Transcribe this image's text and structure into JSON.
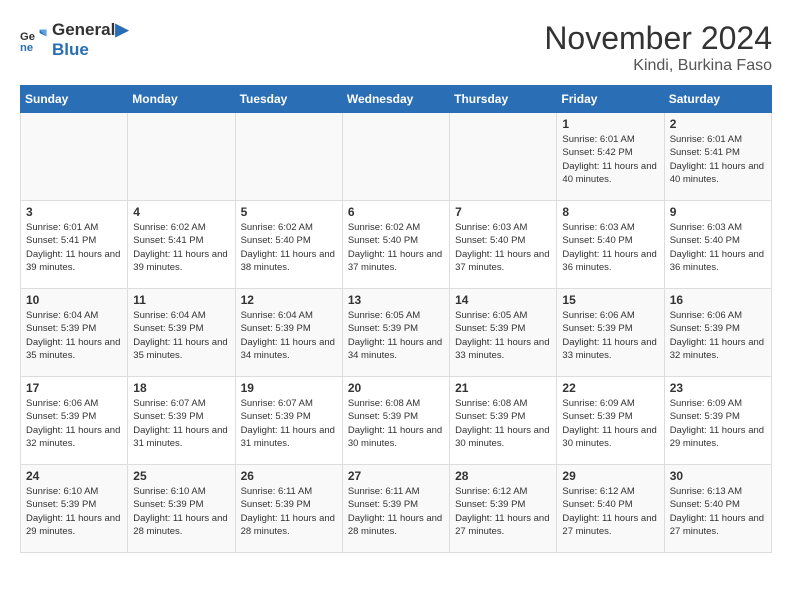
{
  "logo": {
    "line1": "General",
    "line2": "Blue"
  },
  "title": "November 2024",
  "subtitle": "Kindi, Burkina Faso",
  "days_of_week": [
    "Sunday",
    "Monday",
    "Tuesday",
    "Wednesday",
    "Thursday",
    "Friday",
    "Saturday"
  ],
  "weeks": [
    [
      {
        "day": "",
        "info": ""
      },
      {
        "day": "",
        "info": ""
      },
      {
        "day": "",
        "info": ""
      },
      {
        "day": "",
        "info": ""
      },
      {
        "day": "",
        "info": ""
      },
      {
        "day": "1",
        "info": "Sunrise: 6:01 AM\nSunset: 5:42 PM\nDaylight: 11 hours and 40 minutes."
      },
      {
        "day": "2",
        "info": "Sunrise: 6:01 AM\nSunset: 5:41 PM\nDaylight: 11 hours and 40 minutes."
      }
    ],
    [
      {
        "day": "3",
        "info": "Sunrise: 6:01 AM\nSunset: 5:41 PM\nDaylight: 11 hours and 39 minutes."
      },
      {
        "day": "4",
        "info": "Sunrise: 6:02 AM\nSunset: 5:41 PM\nDaylight: 11 hours and 39 minutes."
      },
      {
        "day": "5",
        "info": "Sunrise: 6:02 AM\nSunset: 5:40 PM\nDaylight: 11 hours and 38 minutes."
      },
      {
        "day": "6",
        "info": "Sunrise: 6:02 AM\nSunset: 5:40 PM\nDaylight: 11 hours and 37 minutes."
      },
      {
        "day": "7",
        "info": "Sunrise: 6:03 AM\nSunset: 5:40 PM\nDaylight: 11 hours and 37 minutes."
      },
      {
        "day": "8",
        "info": "Sunrise: 6:03 AM\nSunset: 5:40 PM\nDaylight: 11 hours and 36 minutes."
      },
      {
        "day": "9",
        "info": "Sunrise: 6:03 AM\nSunset: 5:40 PM\nDaylight: 11 hours and 36 minutes."
      }
    ],
    [
      {
        "day": "10",
        "info": "Sunrise: 6:04 AM\nSunset: 5:39 PM\nDaylight: 11 hours and 35 minutes."
      },
      {
        "day": "11",
        "info": "Sunrise: 6:04 AM\nSunset: 5:39 PM\nDaylight: 11 hours and 35 minutes."
      },
      {
        "day": "12",
        "info": "Sunrise: 6:04 AM\nSunset: 5:39 PM\nDaylight: 11 hours and 34 minutes."
      },
      {
        "day": "13",
        "info": "Sunrise: 6:05 AM\nSunset: 5:39 PM\nDaylight: 11 hours and 34 minutes."
      },
      {
        "day": "14",
        "info": "Sunrise: 6:05 AM\nSunset: 5:39 PM\nDaylight: 11 hours and 33 minutes."
      },
      {
        "day": "15",
        "info": "Sunrise: 6:06 AM\nSunset: 5:39 PM\nDaylight: 11 hours and 33 minutes."
      },
      {
        "day": "16",
        "info": "Sunrise: 6:06 AM\nSunset: 5:39 PM\nDaylight: 11 hours and 32 minutes."
      }
    ],
    [
      {
        "day": "17",
        "info": "Sunrise: 6:06 AM\nSunset: 5:39 PM\nDaylight: 11 hours and 32 minutes."
      },
      {
        "day": "18",
        "info": "Sunrise: 6:07 AM\nSunset: 5:39 PM\nDaylight: 11 hours and 31 minutes."
      },
      {
        "day": "19",
        "info": "Sunrise: 6:07 AM\nSunset: 5:39 PM\nDaylight: 11 hours and 31 minutes."
      },
      {
        "day": "20",
        "info": "Sunrise: 6:08 AM\nSunset: 5:39 PM\nDaylight: 11 hours and 30 minutes."
      },
      {
        "day": "21",
        "info": "Sunrise: 6:08 AM\nSunset: 5:39 PM\nDaylight: 11 hours and 30 minutes."
      },
      {
        "day": "22",
        "info": "Sunrise: 6:09 AM\nSunset: 5:39 PM\nDaylight: 11 hours and 30 minutes."
      },
      {
        "day": "23",
        "info": "Sunrise: 6:09 AM\nSunset: 5:39 PM\nDaylight: 11 hours and 29 minutes."
      }
    ],
    [
      {
        "day": "24",
        "info": "Sunrise: 6:10 AM\nSunset: 5:39 PM\nDaylight: 11 hours and 29 minutes."
      },
      {
        "day": "25",
        "info": "Sunrise: 6:10 AM\nSunset: 5:39 PM\nDaylight: 11 hours and 28 minutes."
      },
      {
        "day": "26",
        "info": "Sunrise: 6:11 AM\nSunset: 5:39 PM\nDaylight: 11 hours and 28 minutes."
      },
      {
        "day": "27",
        "info": "Sunrise: 6:11 AM\nSunset: 5:39 PM\nDaylight: 11 hours and 28 minutes."
      },
      {
        "day": "28",
        "info": "Sunrise: 6:12 AM\nSunset: 5:39 PM\nDaylight: 11 hours and 27 minutes."
      },
      {
        "day": "29",
        "info": "Sunrise: 6:12 AM\nSunset: 5:40 PM\nDaylight: 11 hours and 27 minutes."
      },
      {
        "day": "30",
        "info": "Sunrise: 6:13 AM\nSunset: 5:40 PM\nDaylight: 11 hours and 27 minutes."
      }
    ]
  ]
}
